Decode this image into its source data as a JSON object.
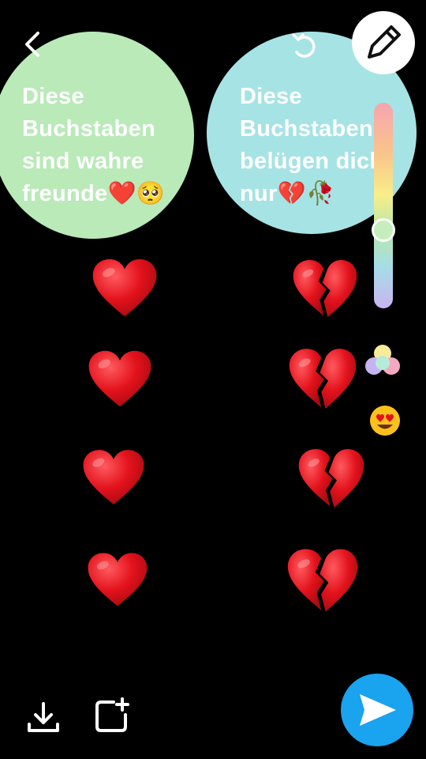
{
  "captions": {
    "left": "Diese\nBuchstaben\nsind wahre\nfreunde❤️🥺",
    "right": "Diese\nBuchstaben\nbelügen dich\nnur💔🥀"
  },
  "colors": {
    "left_bubble": "#b9eab8",
    "right_bubble": "#a6e3e5",
    "heart_red": "#e3121c",
    "send_button": "#1aa3ee"
  },
  "left_column": [
    "heart",
    "heart",
    "heart",
    "heart"
  ],
  "right_column": [
    "broken-heart",
    "broken-heart",
    "broken-heart",
    "broken-heart"
  ],
  "icons": {
    "back": "chevron-left-icon",
    "undo": "undo-icon",
    "draw": "pencil-icon",
    "palette": "color-dots-icon",
    "emoji": "heart-eyes-emoji-icon",
    "save": "download-icon",
    "add_story": "add-to-story-icon",
    "send": "send-arrow-icon"
  }
}
